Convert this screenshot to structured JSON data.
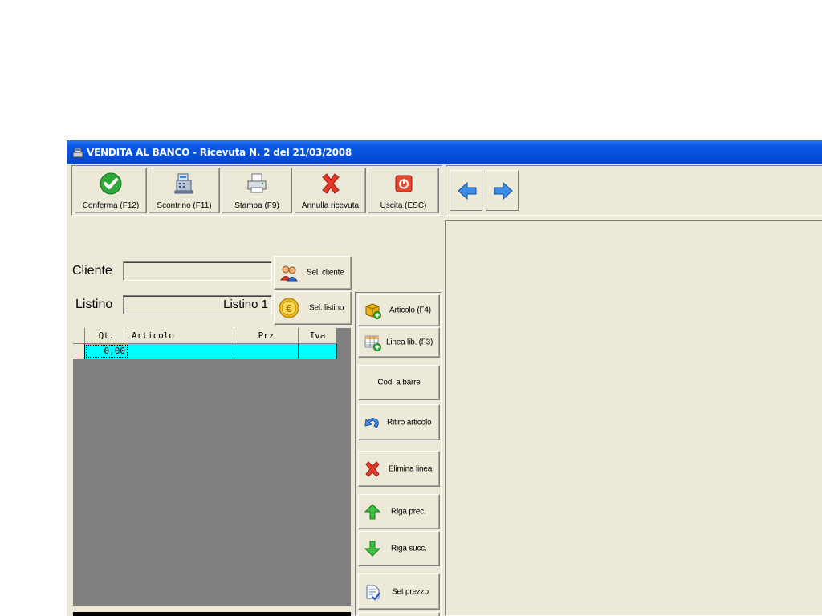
{
  "window": {
    "title": "VENDITA AL BANCO - Ricevuta N. 2 del 21/03/2008"
  },
  "toolbar": {
    "conferma": "Conferma (F12)",
    "scontrino": "Scontrino (F11)",
    "stampa": "Stampa (F9)",
    "annulla": "Annulla ricevuta",
    "uscita": "Uscita (ESC)"
  },
  "form": {
    "cliente_label": "Cliente",
    "cliente_value": "",
    "sel_cliente": "Sel. cliente",
    "listino_label": "Listino",
    "listino_value": "Listino 1",
    "sel_listino": "Sel. listino"
  },
  "grid": {
    "columns": [
      "Qt.",
      "Articolo",
      "Prz",
      "Iva"
    ],
    "rows": [
      {
        "qt": "0,00",
        "articolo": "",
        "prz": "",
        "iva": ""
      }
    ]
  },
  "sidebar": {
    "articolo": "Articolo (F4)",
    "linea_lib": "Linea lib. (F3)",
    "cod_barre": "Cod. a barre",
    "ritiro": "Ritiro articolo",
    "elimina": "Elimina linea",
    "riga_prec": "Riga prec.",
    "riga_succ": "Riga succ.",
    "set_prezzo": "Set prezzo"
  },
  "colors": {
    "title_bar": "#0650dc",
    "grid_selected_row": "#00ffff",
    "grid_background": "#808080"
  }
}
